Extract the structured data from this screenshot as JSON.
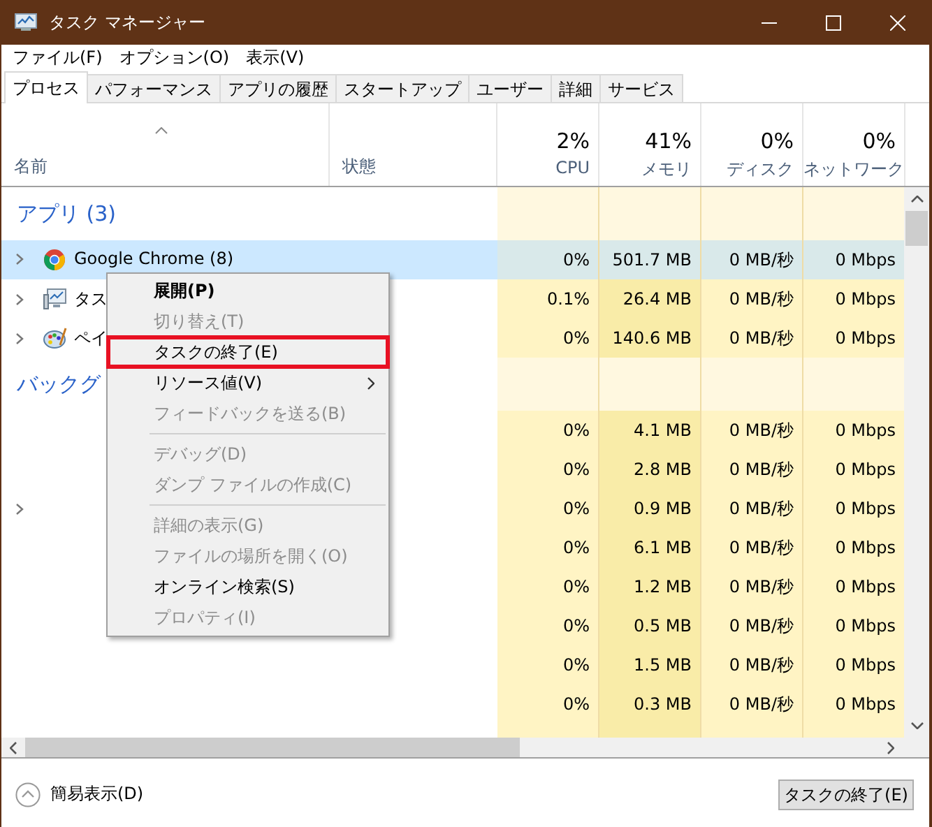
{
  "window": {
    "title": "タスク マネージャー"
  },
  "menu_bar": [
    "ファイル(F)",
    "オプション(O)",
    "表示(V)"
  ],
  "tabs": [
    {
      "label": "プロセス",
      "selected": true
    },
    {
      "label": "パフォーマンス",
      "selected": false
    },
    {
      "label": "アプリの履歴",
      "selected": false
    },
    {
      "label": "スタートアップ",
      "selected": false
    },
    {
      "label": "ユーザー",
      "selected": false
    },
    {
      "label": "詳細",
      "selected": false
    },
    {
      "label": "サービス",
      "selected": false
    }
  ],
  "columns": [
    {
      "kind": "name",
      "label": "名前",
      "sorted": true
    },
    {
      "kind": "status",
      "label": "状態",
      "sorted": false
    },
    {
      "kind": "metric",
      "percent": "2%",
      "label": "CPU",
      "sorted": false,
      "shaded": false
    },
    {
      "kind": "metric",
      "percent": "41%",
      "label": "メモリ",
      "sorted": false,
      "shaded": true
    },
    {
      "kind": "metric",
      "percent": "0%",
      "label": "ディスク",
      "sorted": false,
      "shaded": false
    },
    {
      "kind": "metric",
      "percent": "0%",
      "label": "ネットワーク",
      "sorted": false,
      "shaded": false
    }
  ],
  "groups": [
    {
      "title": "アプリ (3)",
      "rows": [
        {
          "name": "Google Chrome (8)",
          "kind": "chrome",
          "expandable": true,
          "selected": true,
          "cells": [
            "0%",
            "501.7 MB",
            "0 MB/秒",
            "0 Mbps"
          ]
        },
        {
          "name": "タス",
          "kind": "monitor",
          "expandable": true,
          "selected": false,
          "cells": [
            "0.1%",
            "26.4 MB",
            "0 MB/秒",
            "0 Mbps"
          ]
        },
        {
          "name": "ペイ",
          "kind": "palette",
          "expandable": true,
          "selected": false,
          "cells": [
            "0%",
            "140.6 MB",
            "0 MB/秒",
            "0 Mbps"
          ]
        }
      ]
    },
    {
      "title": "バックグ",
      "rows": [
        {
          "expandable": false,
          "selected": false,
          "cells": [
            "0%",
            "4.1 MB",
            "0 MB/秒",
            "0 Mbps"
          ]
        },
        {
          "expandable": false,
          "selected": false,
          "cells": [
            "0%",
            "2.8 MB",
            "0 MB/秒",
            "0 Mbps"
          ]
        },
        {
          "expandable": true,
          "selected": false,
          "cells": [
            "0%",
            "0.9 MB",
            "0 MB/秒",
            "0 Mbps"
          ]
        },
        {
          "expandable": false,
          "selected": false,
          "cells": [
            "0%",
            "6.1 MB",
            "0 MB/秒",
            "0 Mbps"
          ]
        },
        {
          "expandable": false,
          "selected": false,
          "cells": [
            "0%",
            "1.2 MB",
            "0 MB/秒",
            "0 Mbps"
          ]
        },
        {
          "expandable": false,
          "selected": false,
          "cells": [
            "0%",
            "0.5 MB",
            "0 MB/秒",
            "0 Mbps"
          ]
        },
        {
          "expandable": false,
          "selected": false,
          "cells": [
            "0%",
            "1.5 MB",
            "0 MB/秒",
            "0 Mbps"
          ]
        },
        {
          "expandable": false,
          "selected": false,
          "cells": [
            "0%",
            "0.3 MB",
            "0 MB/秒",
            "0 Mbps"
          ]
        }
      ]
    }
  ],
  "context_menu": {
    "items": [
      {
        "kind": "item",
        "label": "展開(P)",
        "default": true,
        "disabled": false,
        "outlined": false,
        "submenu": false
      },
      {
        "kind": "item",
        "label": "切り替え(T)",
        "default": false,
        "disabled": true,
        "outlined": false,
        "submenu": false
      },
      {
        "kind": "item",
        "label": "タスクの終了(E)",
        "default": false,
        "disabled": false,
        "outlined": true,
        "submenu": false
      },
      {
        "kind": "item",
        "label": "リソース値(V)",
        "default": false,
        "disabled": false,
        "outlined": false,
        "submenu": true
      },
      {
        "kind": "item",
        "label": "フィードバックを送る(B)",
        "default": false,
        "disabled": true,
        "outlined": false,
        "submenu": false
      },
      {
        "kind": "separator"
      },
      {
        "kind": "item",
        "label": "デバッグ(D)",
        "default": false,
        "disabled": true,
        "outlined": false,
        "submenu": false
      },
      {
        "kind": "item",
        "label": "ダンプ ファイルの作成(C)",
        "default": false,
        "disabled": true,
        "outlined": false,
        "submenu": false
      },
      {
        "kind": "separator"
      },
      {
        "kind": "item",
        "label": "詳細の表示(G)",
        "default": false,
        "disabled": true,
        "outlined": false,
        "submenu": false
      },
      {
        "kind": "item",
        "label": "ファイルの場所を開く(O)",
        "default": false,
        "disabled": true,
        "outlined": false,
        "submenu": false
      },
      {
        "kind": "item",
        "label": "オンライン検索(S)",
        "default": false,
        "disabled": false,
        "outlined": false,
        "submenu": false
      },
      {
        "kind": "item",
        "label": "プロパティ(I)",
        "default": false,
        "disabled": true,
        "outlined": false,
        "submenu": false
      }
    ]
  },
  "footer": {
    "toggle": "簡易表示(D)",
    "button": "タスクの終了(E)"
  }
}
